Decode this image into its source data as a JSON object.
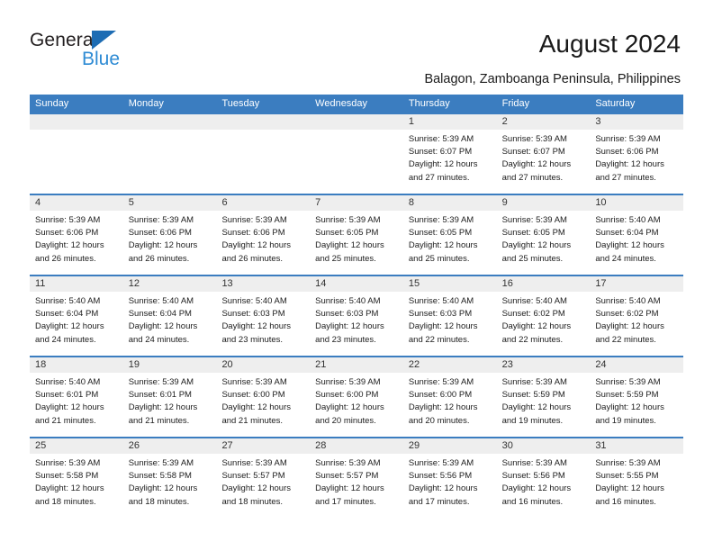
{
  "brand": {
    "name_top": "General",
    "name_bottom": "Blue",
    "triangle_icon": "triangle-icon",
    "accent_color": "#1d6cb3",
    "accent_color_light": "#2e8bd4"
  },
  "header": {
    "title": "August 2024",
    "subtitle": "Balagon, Zamboanga Peninsula, Philippines"
  },
  "calendar": {
    "header_bg": "#3b7dc0",
    "daynum_bg": "#eeeeee",
    "weekdays": [
      "Sunday",
      "Monday",
      "Tuesday",
      "Wednesday",
      "Thursday",
      "Friday",
      "Saturday"
    ],
    "weeks": [
      [
        {
          "day": "",
          "empty": true,
          "sunrise": "",
          "sunset": "",
          "daylight_line1": "",
          "daylight_line2": ""
        },
        {
          "day": "",
          "empty": true,
          "sunrise": "",
          "sunset": "",
          "daylight_line1": "",
          "daylight_line2": ""
        },
        {
          "day": "",
          "empty": true,
          "sunrise": "",
          "sunset": "",
          "daylight_line1": "",
          "daylight_line2": ""
        },
        {
          "day": "",
          "empty": true,
          "sunrise": "",
          "sunset": "",
          "daylight_line1": "",
          "daylight_line2": ""
        },
        {
          "day": "1",
          "empty": false,
          "sunrise": "Sunrise: 5:39 AM",
          "sunset": "Sunset: 6:07 PM",
          "daylight_line1": "Daylight: 12 hours",
          "daylight_line2": "and 27 minutes."
        },
        {
          "day": "2",
          "empty": false,
          "sunrise": "Sunrise: 5:39 AM",
          "sunset": "Sunset: 6:07 PM",
          "daylight_line1": "Daylight: 12 hours",
          "daylight_line2": "and 27 minutes."
        },
        {
          "day": "3",
          "empty": false,
          "sunrise": "Sunrise: 5:39 AM",
          "sunset": "Sunset: 6:06 PM",
          "daylight_line1": "Daylight: 12 hours",
          "daylight_line2": "and 27 minutes."
        }
      ],
      [
        {
          "day": "4",
          "empty": false,
          "sunrise": "Sunrise: 5:39 AM",
          "sunset": "Sunset: 6:06 PM",
          "daylight_line1": "Daylight: 12 hours",
          "daylight_line2": "and 26 minutes."
        },
        {
          "day": "5",
          "empty": false,
          "sunrise": "Sunrise: 5:39 AM",
          "sunset": "Sunset: 6:06 PM",
          "daylight_line1": "Daylight: 12 hours",
          "daylight_line2": "and 26 minutes."
        },
        {
          "day": "6",
          "empty": false,
          "sunrise": "Sunrise: 5:39 AM",
          "sunset": "Sunset: 6:06 PM",
          "daylight_line1": "Daylight: 12 hours",
          "daylight_line2": "and 26 minutes."
        },
        {
          "day": "7",
          "empty": false,
          "sunrise": "Sunrise: 5:39 AM",
          "sunset": "Sunset: 6:05 PM",
          "daylight_line1": "Daylight: 12 hours",
          "daylight_line2": "and 25 minutes."
        },
        {
          "day": "8",
          "empty": false,
          "sunrise": "Sunrise: 5:39 AM",
          "sunset": "Sunset: 6:05 PM",
          "daylight_line1": "Daylight: 12 hours",
          "daylight_line2": "and 25 minutes."
        },
        {
          "day": "9",
          "empty": false,
          "sunrise": "Sunrise: 5:39 AM",
          "sunset": "Sunset: 6:05 PM",
          "daylight_line1": "Daylight: 12 hours",
          "daylight_line2": "and 25 minutes."
        },
        {
          "day": "10",
          "empty": false,
          "sunrise": "Sunrise: 5:40 AM",
          "sunset": "Sunset: 6:04 PM",
          "daylight_line1": "Daylight: 12 hours",
          "daylight_line2": "and 24 minutes."
        }
      ],
      [
        {
          "day": "11",
          "empty": false,
          "sunrise": "Sunrise: 5:40 AM",
          "sunset": "Sunset: 6:04 PM",
          "daylight_line1": "Daylight: 12 hours",
          "daylight_line2": "and 24 minutes."
        },
        {
          "day": "12",
          "empty": false,
          "sunrise": "Sunrise: 5:40 AM",
          "sunset": "Sunset: 6:04 PM",
          "daylight_line1": "Daylight: 12 hours",
          "daylight_line2": "and 24 minutes."
        },
        {
          "day": "13",
          "empty": false,
          "sunrise": "Sunrise: 5:40 AM",
          "sunset": "Sunset: 6:03 PM",
          "daylight_line1": "Daylight: 12 hours",
          "daylight_line2": "and 23 minutes."
        },
        {
          "day": "14",
          "empty": false,
          "sunrise": "Sunrise: 5:40 AM",
          "sunset": "Sunset: 6:03 PM",
          "daylight_line1": "Daylight: 12 hours",
          "daylight_line2": "and 23 minutes."
        },
        {
          "day": "15",
          "empty": false,
          "sunrise": "Sunrise: 5:40 AM",
          "sunset": "Sunset: 6:03 PM",
          "daylight_line1": "Daylight: 12 hours",
          "daylight_line2": "and 22 minutes."
        },
        {
          "day": "16",
          "empty": false,
          "sunrise": "Sunrise: 5:40 AM",
          "sunset": "Sunset: 6:02 PM",
          "daylight_line1": "Daylight: 12 hours",
          "daylight_line2": "and 22 minutes."
        },
        {
          "day": "17",
          "empty": false,
          "sunrise": "Sunrise: 5:40 AM",
          "sunset": "Sunset: 6:02 PM",
          "daylight_line1": "Daylight: 12 hours",
          "daylight_line2": "and 22 minutes."
        }
      ],
      [
        {
          "day": "18",
          "empty": false,
          "sunrise": "Sunrise: 5:40 AM",
          "sunset": "Sunset: 6:01 PM",
          "daylight_line1": "Daylight: 12 hours",
          "daylight_line2": "and 21 minutes."
        },
        {
          "day": "19",
          "empty": false,
          "sunrise": "Sunrise: 5:39 AM",
          "sunset": "Sunset: 6:01 PM",
          "daylight_line1": "Daylight: 12 hours",
          "daylight_line2": "and 21 minutes."
        },
        {
          "day": "20",
          "empty": false,
          "sunrise": "Sunrise: 5:39 AM",
          "sunset": "Sunset: 6:00 PM",
          "daylight_line1": "Daylight: 12 hours",
          "daylight_line2": "and 21 minutes."
        },
        {
          "day": "21",
          "empty": false,
          "sunrise": "Sunrise: 5:39 AM",
          "sunset": "Sunset: 6:00 PM",
          "daylight_line1": "Daylight: 12 hours",
          "daylight_line2": "and 20 minutes."
        },
        {
          "day": "22",
          "empty": false,
          "sunrise": "Sunrise: 5:39 AM",
          "sunset": "Sunset: 6:00 PM",
          "daylight_line1": "Daylight: 12 hours",
          "daylight_line2": "and 20 minutes."
        },
        {
          "day": "23",
          "empty": false,
          "sunrise": "Sunrise: 5:39 AM",
          "sunset": "Sunset: 5:59 PM",
          "daylight_line1": "Daylight: 12 hours",
          "daylight_line2": "and 19 minutes."
        },
        {
          "day": "24",
          "empty": false,
          "sunrise": "Sunrise: 5:39 AM",
          "sunset": "Sunset: 5:59 PM",
          "daylight_line1": "Daylight: 12 hours",
          "daylight_line2": "and 19 minutes."
        }
      ],
      [
        {
          "day": "25",
          "empty": false,
          "sunrise": "Sunrise: 5:39 AM",
          "sunset": "Sunset: 5:58 PM",
          "daylight_line1": "Daylight: 12 hours",
          "daylight_line2": "and 18 minutes."
        },
        {
          "day": "26",
          "empty": false,
          "sunrise": "Sunrise: 5:39 AM",
          "sunset": "Sunset: 5:58 PM",
          "daylight_line1": "Daylight: 12 hours",
          "daylight_line2": "and 18 minutes."
        },
        {
          "day": "27",
          "empty": false,
          "sunrise": "Sunrise: 5:39 AM",
          "sunset": "Sunset: 5:57 PM",
          "daylight_line1": "Daylight: 12 hours",
          "daylight_line2": "and 18 minutes."
        },
        {
          "day": "28",
          "empty": false,
          "sunrise": "Sunrise: 5:39 AM",
          "sunset": "Sunset: 5:57 PM",
          "daylight_line1": "Daylight: 12 hours",
          "daylight_line2": "and 17 minutes."
        },
        {
          "day": "29",
          "empty": false,
          "sunrise": "Sunrise: 5:39 AM",
          "sunset": "Sunset: 5:56 PM",
          "daylight_line1": "Daylight: 12 hours",
          "daylight_line2": "and 17 minutes."
        },
        {
          "day": "30",
          "empty": false,
          "sunrise": "Sunrise: 5:39 AM",
          "sunset": "Sunset: 5:56 PM",
          "daylight_line1": "Daylight: 12 hours",
          "daylight_line2": "and 16 minutes."
        },
        {
          "day": "31",
          "empty": false,
          "sunrise": "Sunrise: 5:39 AM",
          "sunset": "Sunset: 5:55 PM",
          "daylight_line1": "Daylight: 12 hours",
          "daylight_line2": "and 16 minutes."
        }
      ]
    ]
  }
}
